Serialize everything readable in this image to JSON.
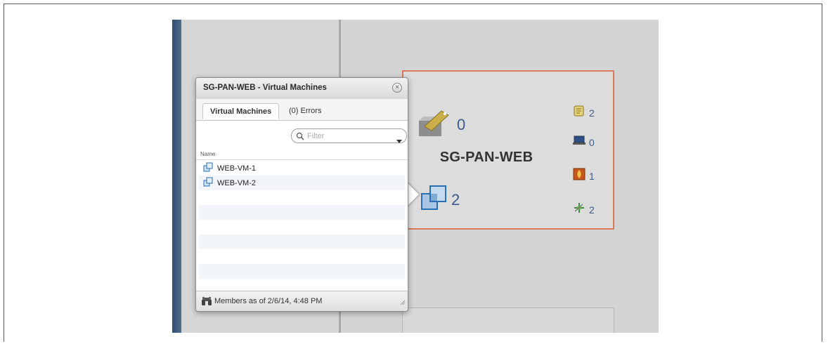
{
  "popup": {
    "title": "SG-PAN-WEB - Virtual Machines",
    "tabs": [
      {
        "label": "Virtual Machines"
      },
      {
        "label": "(0) Errors"
      }
    ],
    "filter": {
      "placeholder": "Filter"
    },
    "column_header": "Name",
    "rows": [
      {
        "name": "WEB-VM-1"
      },
      {
        "name": "WEB-VM-2"
      }
    ],
    "footer": "Members as of 2/6/14, 4:48 PM"
  },
  "security_group": {
    "name": "SG-PAN-WEB",
    "policy_count": "0",
    "vm_count": "2",
    "metrics": {
      "rules": "2",
      "hosts": "0",
      "firewall": "1",
      "network": "2"
    }
  },
  "colors": {
    "card_border": "#d9785a",
    "metric_text": "#3c5a8c",
    "left_strip": "#2f4d6d"
  },
  "icons": [
    "binoculars-icon",
    "vm-icon",
    "policy-tag-icon",
    "scroll-icon",
    "laptop-icon",
    "firewall-icon",
    "network-icon",
    "search-icon",
    "close-icon",
    "dropdown-caret-icon"
  ]
}
